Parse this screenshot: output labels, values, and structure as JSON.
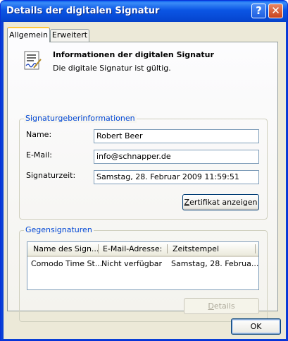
{
  "window": {
    "title": "Details der digitalen Signatur",
    "help_label": "?",
    "close_label": "✕"
  },
  "tabs": [
    {
      "label": "Allgemein",
      "active": true
    },
    {
      "label": "Erweitert",
      "active": false
    }
  ],
  "info": {
    "icon": "document-signature-icon",
    "title": "Informationen der digitalen Signatur",
    "text": "Die digitale Signatur ist gültig."
  },
  "signer": {
    "legend": "Signaturgeberinformationen",
    "name_label": "Name:",
    "name_value": "Robert Beer",
    "email_label": "E-Mail:",
    "email_value": "info@schnapper.de",
    "time_label": "Signaturzeit:",
    "time_value": "Samstag, 28. Februar 2009 11:59:51",
    "cert_button": {
      "prefix": "Z",
      "rest": "ertifikat anzeigen"
    }
  },
  "countersignatures": {
    "legend": "Gegensignaturen",
    "columns": [
      "Name des Sign...",
      "E-Mail-Adresse:",
      "Zeitstempel"
    ],
    "rows": [
      [
        "Comodo Time St...",
        "Nicht verfügbar",
        "Samstag, 28. Februa..."
      ]
    ],
    "details_button": {
      "prefix": "D",
      "rest": "etails"
    }
  },
  "footer": {
    "ok_label": "OK"
  },
  "colors": {
    "titlebar": "#0a55e4",
    "dialog_bg": "#ece9d8",
    "group_legend": "#0046d5",
    "active_tab_accent": "#ffc73c"
  }
}
